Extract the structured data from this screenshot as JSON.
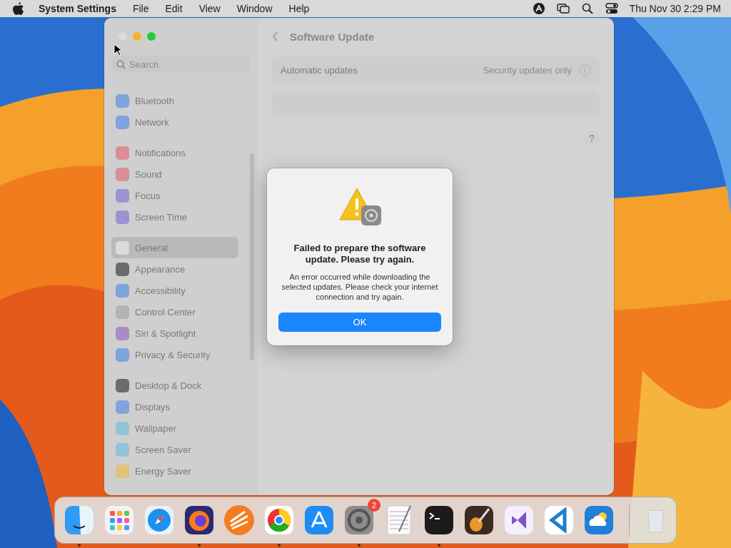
{
  "menu_bar": {
    "app_name": "System Settings",
    "menus": [
      "File",
      "Edit",
      "View",
      "Window",
      "Help"
    ],
    "clock": "Thu Nov 30  2:29 PM"
  },
  "window": {
    "search": {
      "placeholder": "Search"
    },
    "sidebar": {
      "groups": [
        {
          "items": [
            {
              "label": "Bluetooth",
              "selected": false,
              "color": "#7fa3dc"
            },
            {
              "label": "Network",
              "selected": false,
              "color": "#7fa3dc"
            }
          ]
        },
        {
          "items": [
            {
              "label": "Notifications",
              "selected": false,
              "color": "#d98f93"
            },
            {
              "label": "Sound",
              "selected": false,
              "color": "#d98f93"
            },
            {
              "label": "Focus",
              "selected": false,
              "color": "#9a93d2"
            },
            {
              "label": "Screen Time",
              "selected": false,
              "color": "#9a93d2"
            }
          ]
        },
        {
          "items": [
            {
              "label": "General",
              "selected": true,
              "color": "#dadada"
            },
            {
              "label": "Appearance",
              "selected": false,
              "color": "#6b6b6b"
            },
            {
              "label": "Accessibility",
              "selected": false,
              "color": "#7fa3dc"
            },
            {
              "label": "Control Center",
              "selected": false,
              "color": "#b3b3b3"
            },
            {
              "label": "Siri & Spotlight",
              "selected": false,
              "color": "#a98cc4"
            },
            {
              "label": "Privacy & Security",
              "selected": false,
              "color": "#7fa3dc"
            }
          ]
        },
        {
          "items": [
            {
              "label": "Desktop & Dock",
              "selected": false,
              "color": "#6b6b6b"
            },
            {
              "label": "Displays",
              "selected": false,
              "color": "#7fa3dc"
            },
            {
              "label": "Wallpaper",
              "selected": false,
              "color": "#93c3d6"
            },
            {
              "label": "Screen Saver",
              "selected": false,
              "color": "#93c3d6"
            },
            {
              "label": "Energy Saver",
              "selected": false,
              "color": "#e2c278"
            }
          ]
        }
      ]
    },
    "page_title": "Software Update",
    "settings": [
      {
        "label": "Automatic updates",
        "value": "Security updates only"
      }
    ],
    "help_button": "?"
  },
  "dialog": {
    "title": "Failed to prepare the software update. Please try again.",
    "message": "An error occurred while downloading the selected updates. Please check your internet connection and try again.",
    "button": "OK"
  },
  "dock": {
    "apps": [
      {
        "kind": "finder",
        "running": true
      },
      {
        "kind": "grid",
        "running": false
      },
      {
        "kind": "compass",
        "running": false
      },
      {
        "kind": "fox",
        "running": true
      },
      {
        "kind": "rays",
        "running": false
      },
      {
        "kind": "rings",
        "running": true
      },
      {
        "kind": "letter",
        "running": false
      },
      {
        "kind": "gear",
        "running": true,
        "badge": "2"
      },
      {
        "kind": "notepad",
        "running": false
      },
      {
        "kind": "terminal",
        "running": true
      },
      {
        "kind": "guitar",
        "running": false
      },
      {
        "kind": "studio",
        "running": false
      },
      {
        "kind": "code",
        "running": false
      },
      {
        "kind": "cloud",
        "running": false
      }
    ]
  }
}
